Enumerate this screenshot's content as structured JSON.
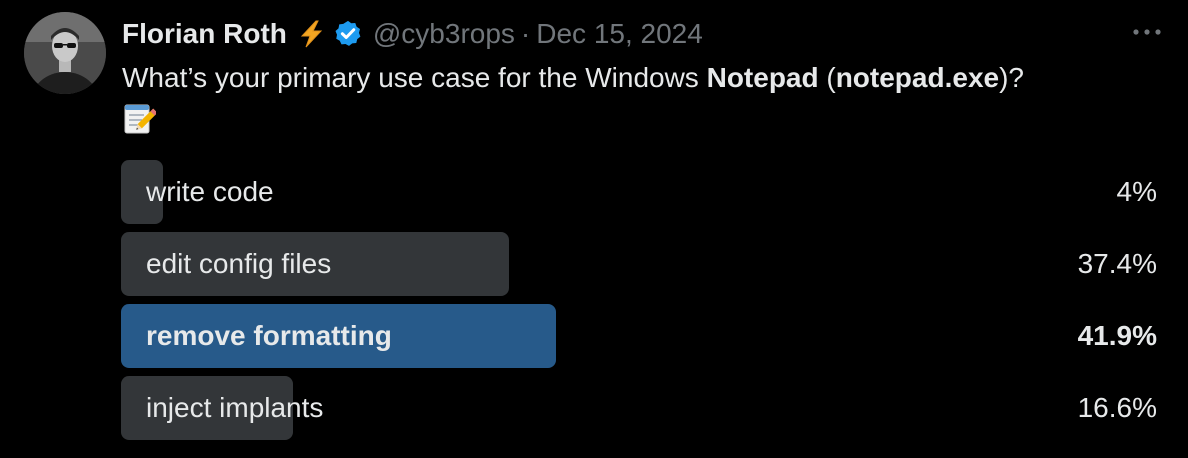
{
  "author": {
    "display_name": "Florian Roth",
    "handle": "@cyb3rops",
    "separator": "·",
    "date": "Dec 15, 2024",
    "badges": [
      "high-voltage-icon",
      "verified-badge-icon"
    ]
  },
  "tweet": {
    "text_prefix": "What’s your primary use case for the Windows ",
    "text_bold_1": "Notepad",
    "text_middle": " (",
    "text_bold_2": "notepad.exe",
    "text_suffix": ")?",
    "emoji": "memo-icon"
  },
  "poll": {
    "options": [
      {
        "label": "write code",
        "percent_text": "4%",
        "percent": 4.0,
        "winner": false
      },
      {
        "label": "edit config files",
        "percent_text": "37.4%",
        "percent": 37.4,
        "winner": false
      },
      {
        "label": "remove formatting",
        "percent_text": "41.9%",
        "percent": 41.9,
        "winner": true
      },
      {
        "label": "inject implants",
        "percent_text": "16.6%",
        "percent": 16.6,
        "winner": false
      }
    ]
  },
  "colors": {
    "background": "#000000",
    "text_primary": "#e7e9ea",
    "text_secondary": "#71767b",
    "poll_bar": "#333639",
    "poll_bar_winner": "#275a8a",
    "verified_blue": "#1d9bf0",
    "bolt_yellow": "#f4a622"
  }
}
